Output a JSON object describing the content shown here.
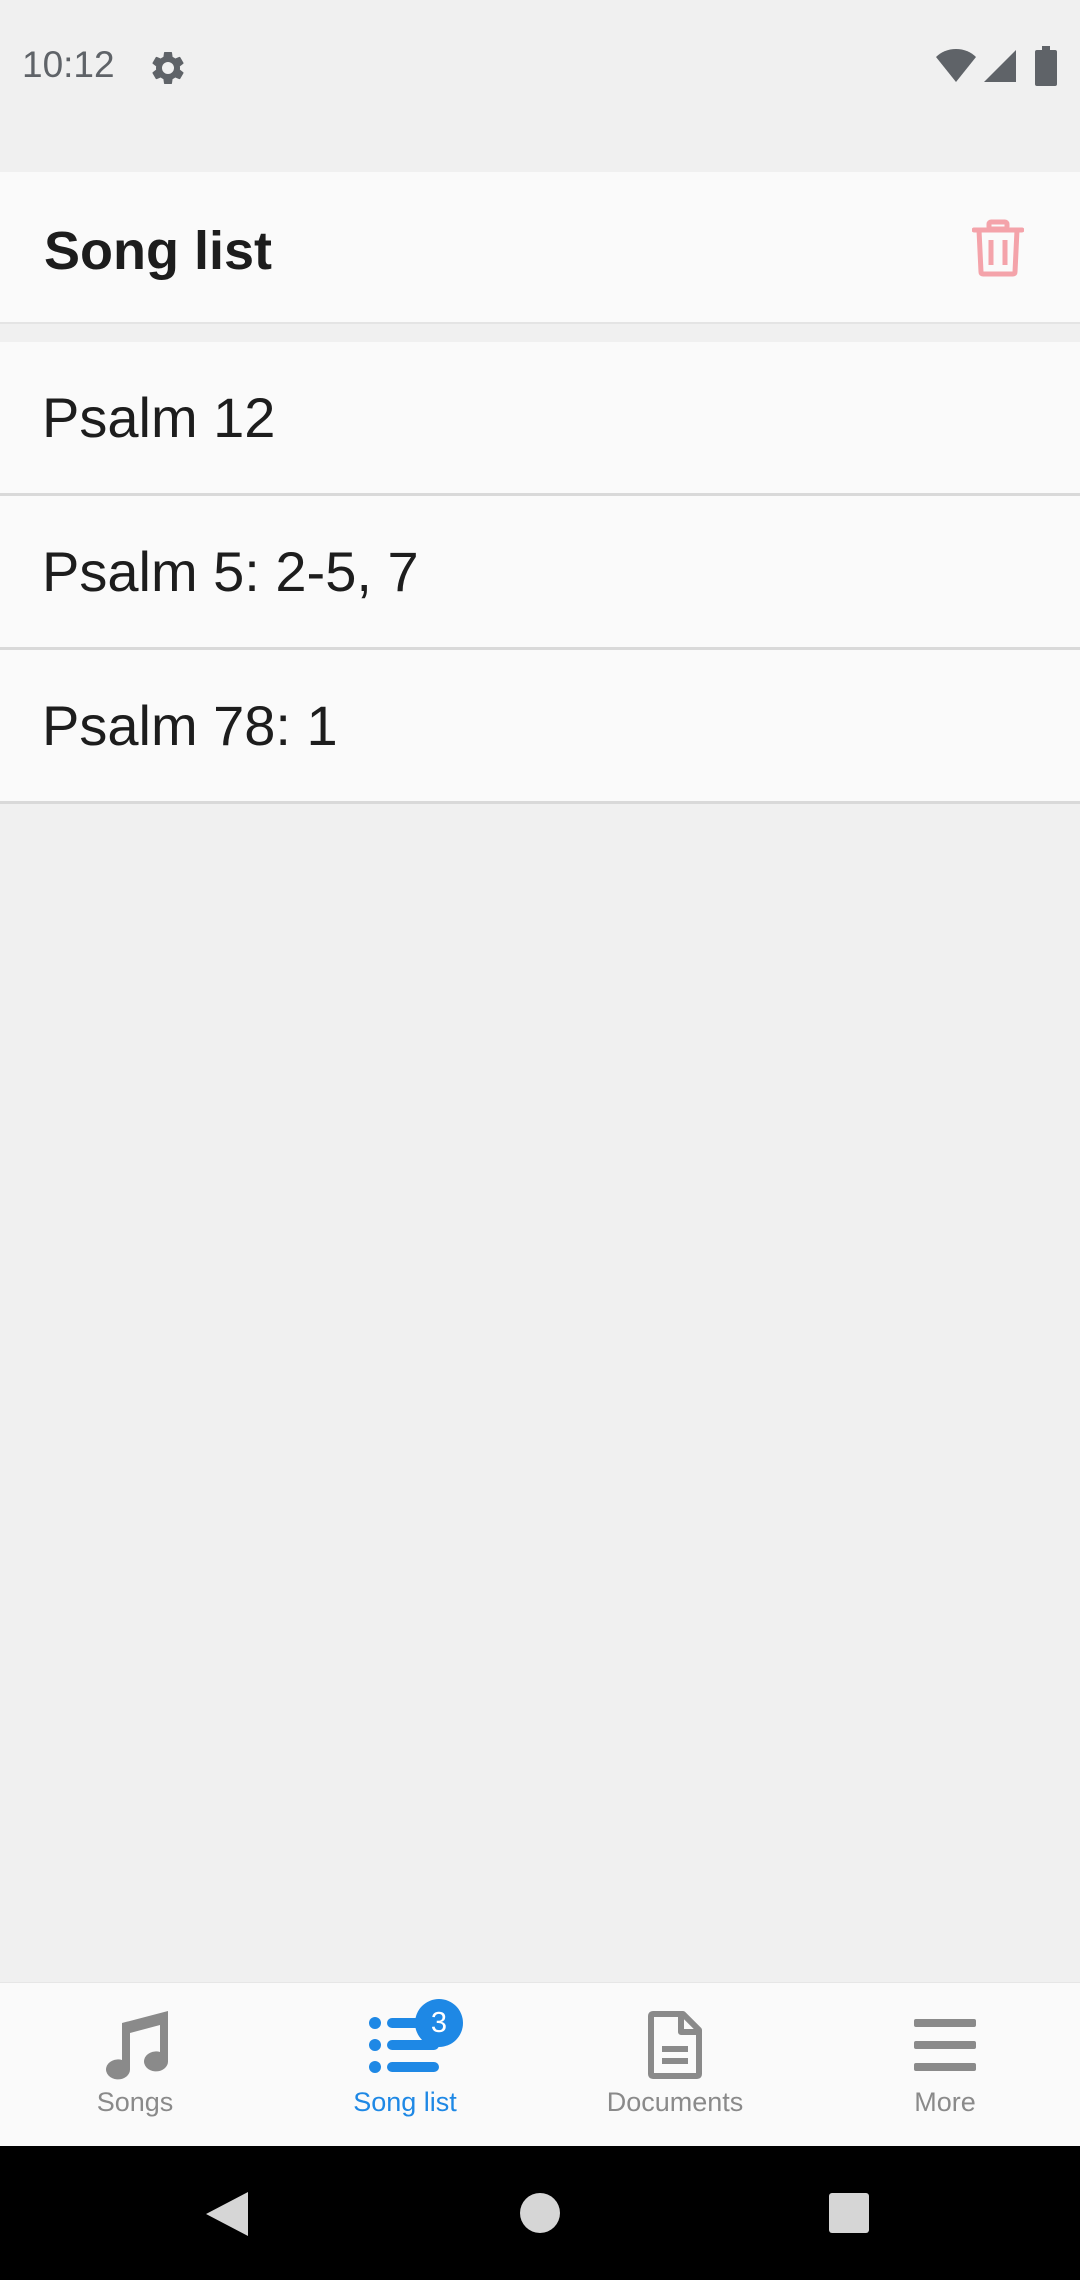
{
  "status_bar": {
    "time": "10:12",
    "icons": [
      "gear-icon",
      "wifi-icon",
      "signal-icon",
      "battery-icon"
    ]
  },
  "header": {
    "title": "Song list",
    "delete_icon": "trash-icon",
    "delete_icon_color": "#f4a3aa"
  },
  "songs": [
    {
      "title": "Psalm 12"
    },
    {
      "title": "Psalm 5: 2-5, 7"
    },
    {
      "title": "Psalm 78: 1"
    }
  ],
  "bottom_nav": {
    "active_color": "#1e88e5",
    "inactive_color": "#8a8a8a",
    "items": [
      {
        "label": "Songs",
        "icon": "music-note-icon",
        "active": false
      },
      {
        "label": "Song list",
        "icon": "list-icon",
        "active": true,
        "badge": "3"
      },
      {
        "label": "Documents",
        "icon": "document-icon",
        "active": false
      },
      {
        "label": "More",
        "icon": "menu-icon",
        "active": false
      }
    ]
  },
  "system_nav": {
    "icons": [
      "back-icon",
      "home-icon",
      "recents-icon"
    ]
  }
}
